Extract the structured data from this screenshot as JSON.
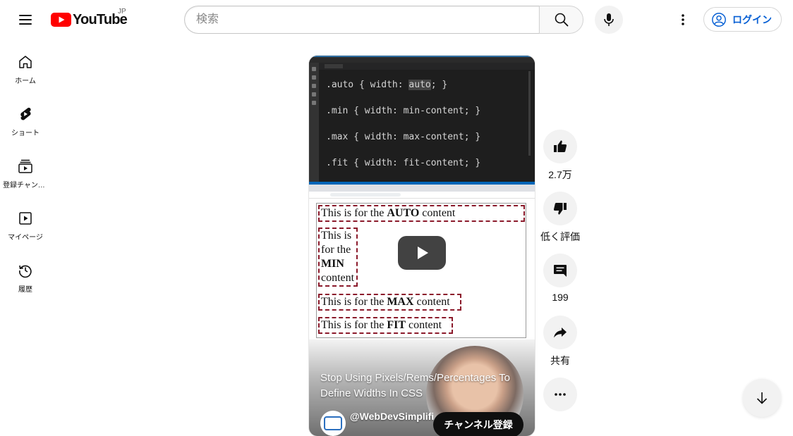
{
  "header": {
    "logo_text": "YouTube",
    "country_code": "JP",
    "search_placeholder": "検索",
    "login_label": "ログイン"
  },
  "sidebar": {
    "items": [
      {
        "label": "ホーム",
        "icon": "home-icon"
      },
      {
        "label": "ショート",
        "icon": "shorts-icon"
      },
      {
        "label": "登録チャンネル",
        "icon": "subscriptions-icon"
      },
      {
        "label": "マイページ",
        "icon": "library-icon"
      },
      {
        "label": "履歴",
        "icon": "history-icon"
      }
    ]
  },
  "short": {
    "code_lines": [
      {
        "selector": ".auto",
        "prop": "width",
        "value": "auto"
      },
      {
        "selector": ".min",
        "prop": "width",
        "value": "min-content"
      },
      {
        "selector": ".max",
        "prop": "width",
        "value": "max-content"
      },
      {
        "selector": ".fit",
        "prop": "width",
        "value": "fit-content"
      }
    ],
    "boxes": [
      {
        "prefix": "This is for the ",
        "strong": "AUTO",
        "suffix": " content"
      },
      {
        "lines": [
          "This is",
          "for the"
        ],
        "strong": "MIN",
        "suffix": "content"
      },
      {
        "prefix": "This is for the ",
        "strong": "MAX",
        "suffix": " content"
      },
      {
        "prefix": "This is for the ",
        "strong": "FIT",
        "suffix": " content"
      }
    ],
    "title": "Stop Using Pixels/Rems/Percentages To Define Widths In CSS",
    "channel": "@WebDevSimplifi",
    "subscribe_label": "チャンネル登録"
  },
  "actions": {
    "like_count": "2.7万",
    "dislike_label": "低く評価",
    "comment_count": "199",
    "share_label": "共有"
  },
  "colors": {
    "brand_red": "#ff0000",
    "link_blue": "#065fd4",
    "box_border": "#8b1a2b"
  }
}
